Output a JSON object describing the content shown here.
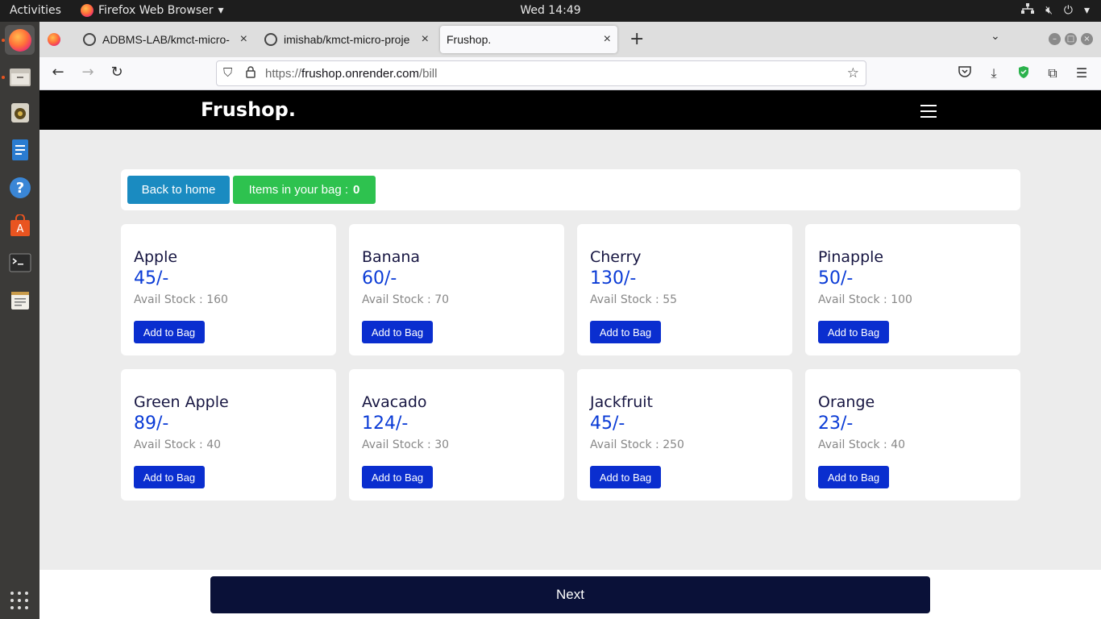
{
  "topbar": {
    "activities": "Activities",
    "app_name": "Firefox Web Browser",
    "clock": "Wed 14:49"
  },
  "browser": {
    "tabs": [
      {
        "title": "ADBMS-LAB/kmct-micro-"
      },
      {
        "title": "imishab/kmct-micro-proje"
      },
      {
        "title": "Frushop."
      }
    ],
    "url_prefix": "https://",
    "url_domain": "frushop.onrender.com",
    "url_path": "/bill"
  },
  "site": {
    "brand": "Frushop.",
    "back_label": "Back to home",
    "bag_label": "Items in your bag :",
    "bag_count": "0",
    "next_label": "Next"
  },
  "products": [
    {
      "name": "Apple",
      "price": "45/-",
      "stock": "Avail Stock : 160",
      "button": "Add to Bag"
    },
    {
      "name": "Banana",
      "price": "60/-",
      "stock": "Avail Stock : 70",
      "button": "Add to Bag"
    },
    {
      "name": "Cherry",
      "price": "130/-",
      "stock": "Avail Stock : 55",
      "button": "Add to Bag"
    },
    {
      "name": "Pinapple",
      "price": "50/-",
      "stock": "Avail Stock : 100",
      "button": "Add to Bag"
    },
    {
      "name": "Green Apple",
      "price": "89/-",
      "stock": "Avail Stock : 40",
      "button": "Add to Bag"
    },
    {
      "name": "Avacado",
      "price": "124/-",
      "stock": "Avail Stock : 30",
      "button": "Add to Bag"
    },
    {
      "name": "Jackfruit",
      "price": "45/-",
      "stock": "Avail Stock : 250",
      "button": "Add to Bag"
    },
    {
      "name": "Orange",
      "price": "23/-",
      "stock": "Avail Stock : 40",
      "button": "Add to Bag"
    }
  ]
}
